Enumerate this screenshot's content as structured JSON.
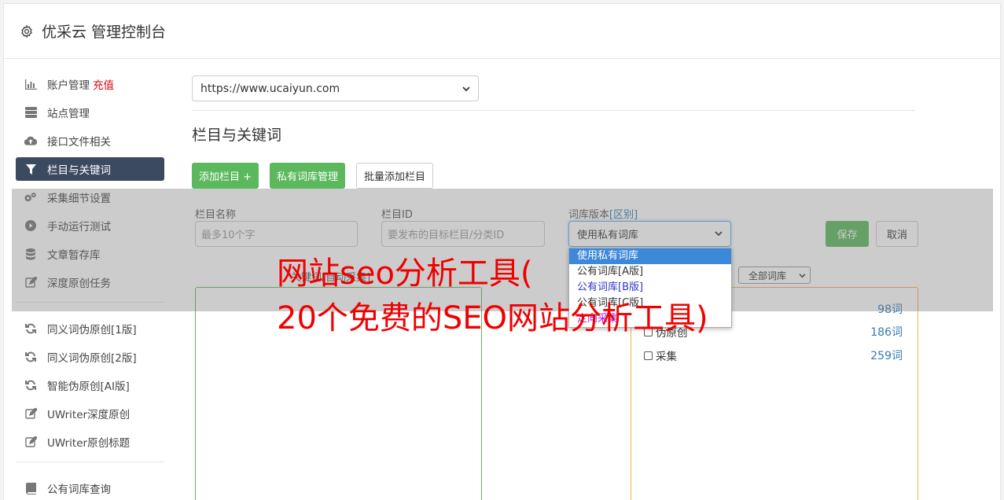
{
  "app": {
    "title": "优采云 管理控制台"
  },
  "sidebar": {
    "items": [
      {
        "label": "账户管理",
        "badge": "充值",
        "icon": "bar-chart-icon"
      },
      {
        "label": "站点管理",
        "icon": "server-icon"
      },
      {
        "label": "接口文件相关",
        "icon": "cloud-upload-icon"
      },
      {
        "label": "栏目与关键词",
        "icon": "filter-icon",
        "active": true
      },
      {
        "label": "采集细节设置",
        "icon": "gears-icon"
      },
      {
        "label": "手动运行测试",
        "icon": "play-circle-icon"
      },
      {
        "label": "文章暂存库",
        "icon": "database-icon"
      },
      {
        "label": "深度原创任务",
        "icon": "edit-icon"
      }
    ],
    "items2": [
      {
        "label": "同义词伪原创[1版]",
        "icon": "refresh-icon"
      },
      {
        "label": "同义词伪原创[2版]",
        "icon": "refresh-icon"
      },
      {
        "label": "智能伪原创[AI版]",
        "icon": "refresh-icon"
      },
      {
        "label": "UWriter深度原创",
        "icon": "edit-icon"
      },
      {
        "label": "UWriter原创标题",
        "icon": "edit-icon"
      }
    ],
    "items3": [
      {
        "label": "公有词库查询",
        "icon": "book-icon"
      }
    ]
  },
  "main": {
    "site_select": "https://www.ucaiyun.com",
    "section_title": "栏目与关键词",
    "buttons": {
      "add_column": "添加栏目 +",
      "private_lib": "私有词库管理",
      "batch_add": "批量添加栏目"
    },
    "form": {
      "col_name_label": "栏目名称",
      "col_name_placeholder": "最多10个字",
      "col_id_label": "栏目ID",
      "col_id_placeholder": "要发布的目标栏目/分类ID",
      "lib_version_label": "词库版本",
      "lib_version_link": "[区别]",
      "lib_version_value": "使用私有词库",
      "save": "保存",
      "cancel": "取消"
    },
    "dropdown_options": [
      "使用私有词库",
      "公有词库[A版]",
      "公有词库[B版]",
      "公有词库[C版]",
      "定向采集"
    ],
    "left_box_label": "关键词[自动采集]",
    "lib_filter": "全部词库",
    "libs": [
      {
        "name": "",
        "count": "98词"
      },
      {
        "name": "伪原创",
        "count": "186词"
      },
      {
        "name": "采集",
        "count": "259词"
      }
    ]
  },
  "watermark": {
    "line1": "网站seo分析工具(",
    "line2": "20个免费的SEO网站分析工具)"
  },
  "colors": {
    "active_nav": "#3c4a5f",
    "green": "#5cb85c",
    "orange": "#f0ad4e",
    "link": "#337ab7",
    "badge": "#e0000a",
    "watermark": "#f00000"
  }
}
